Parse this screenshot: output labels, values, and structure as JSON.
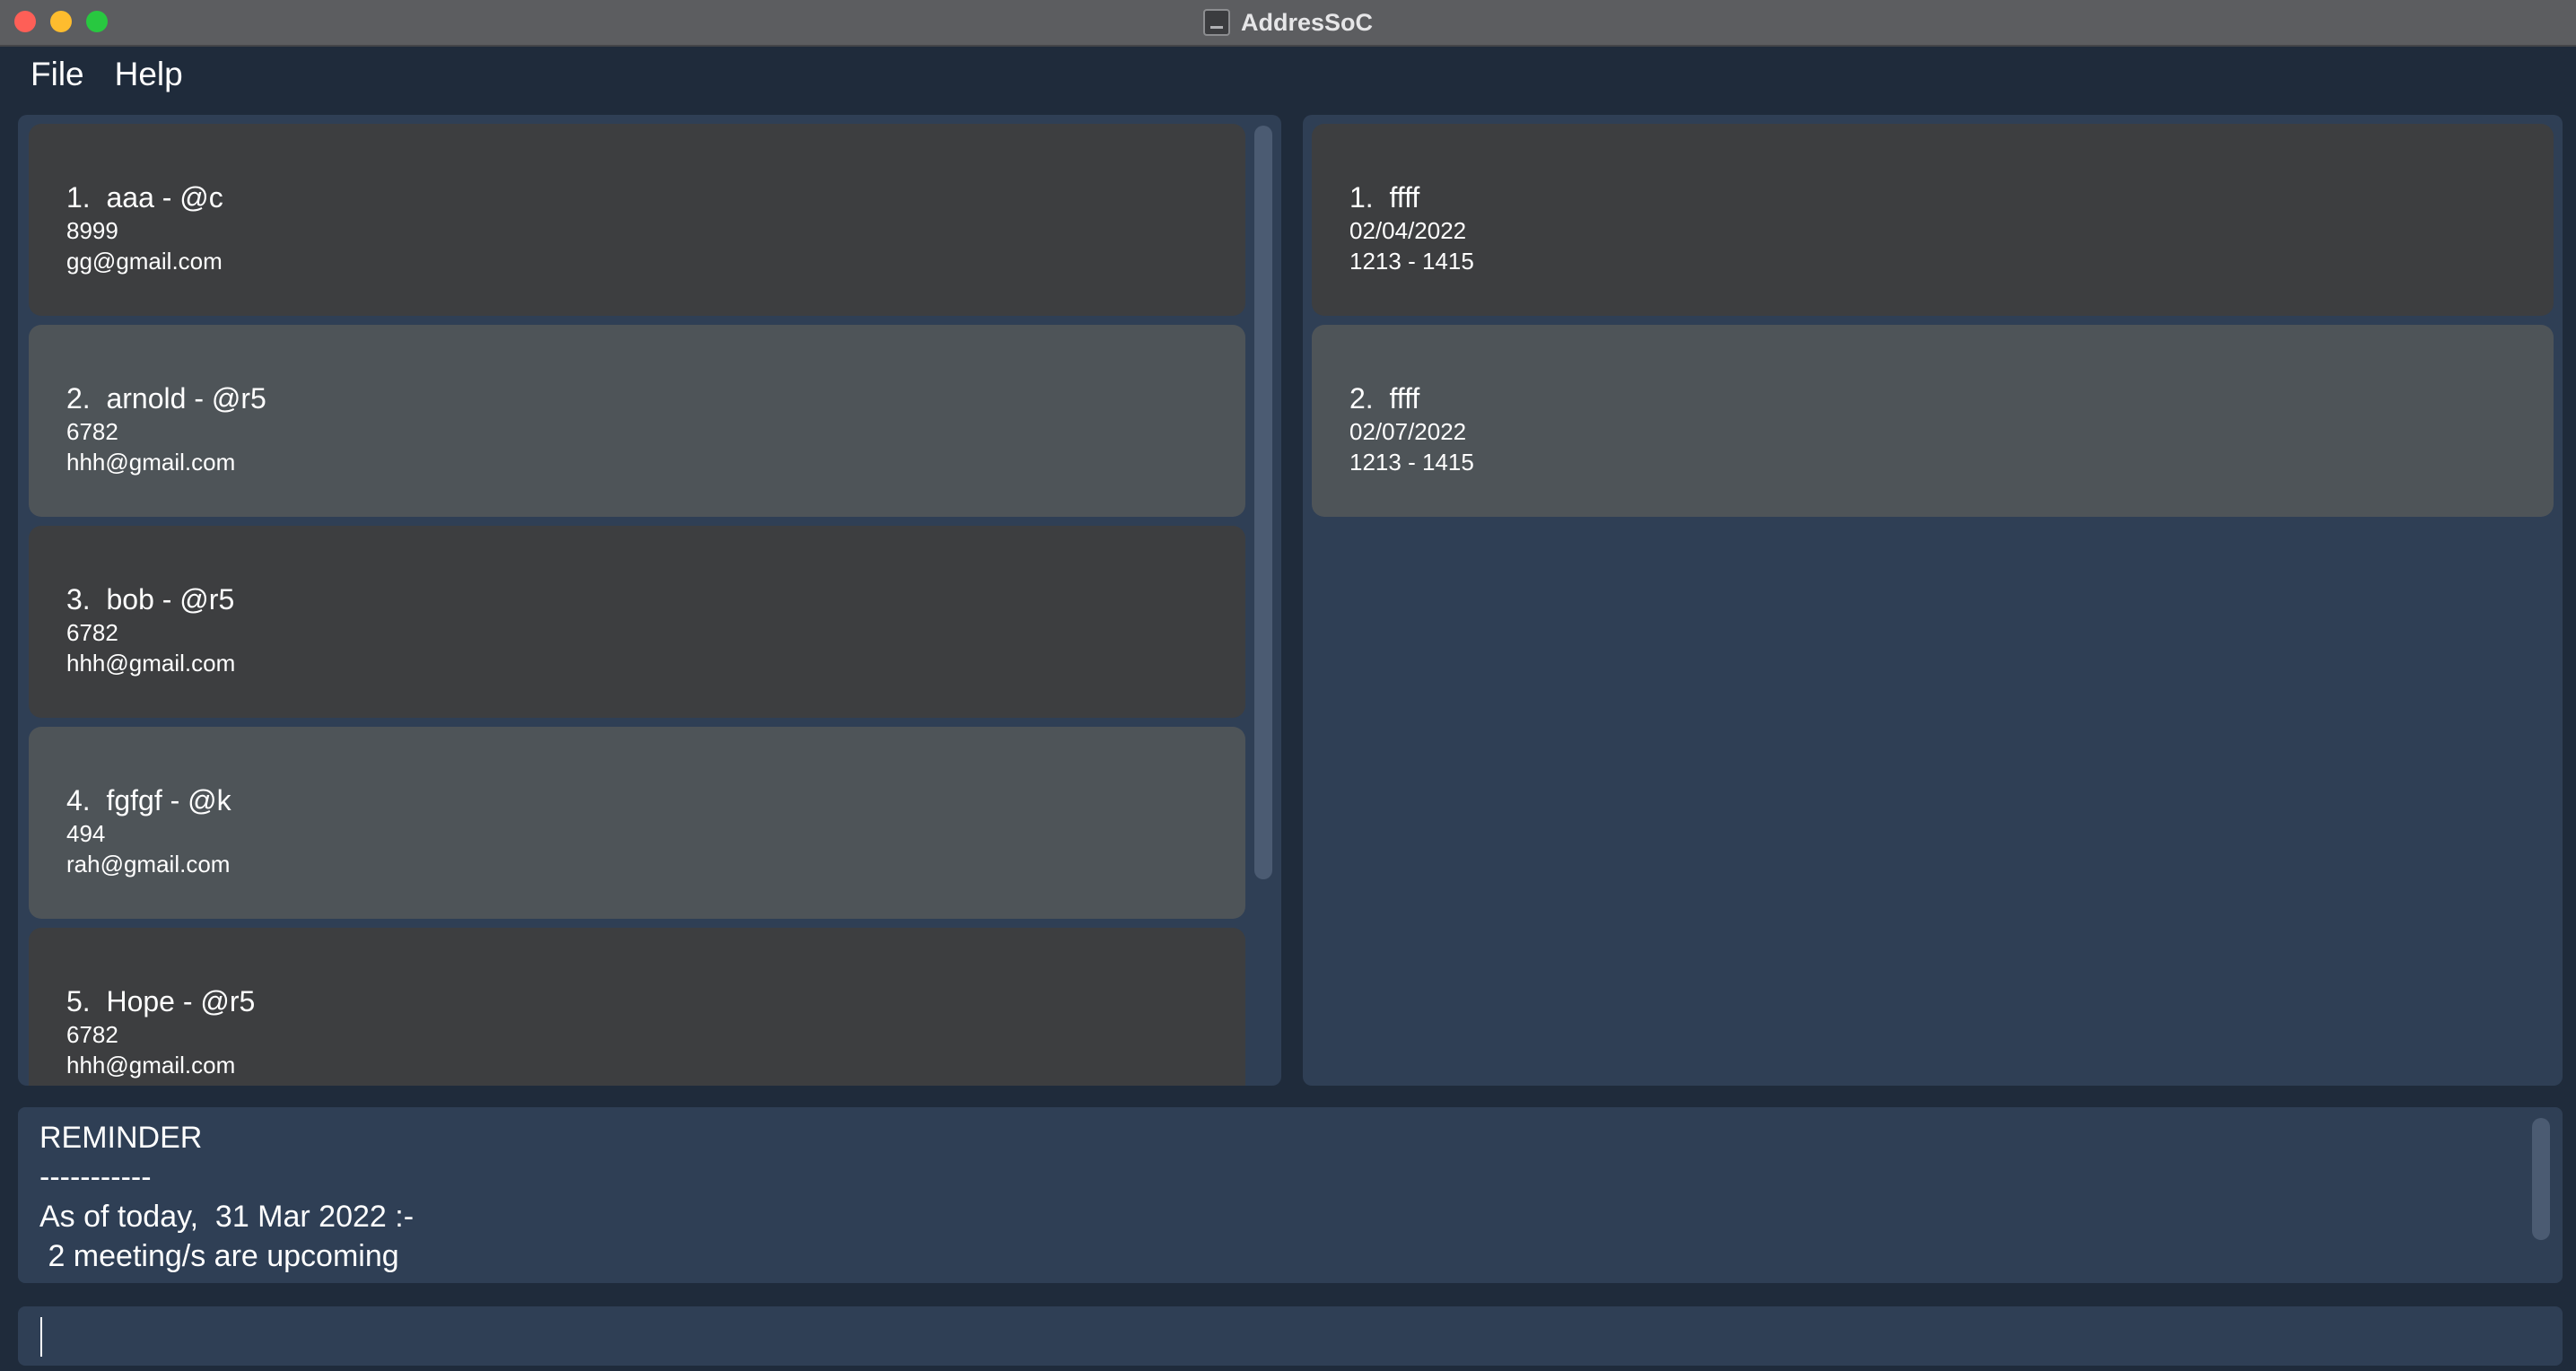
{
  "window": {
    "title": "AddresSoC",
    "icon": "app-window-icon"
  },
  "menu": {
    "file_label": "File",
    "help_label": "Help"
  },
  "persons": [
    {
      "index_name": "1.  aaa - @c",
      "phone": "8999",
      "email": "gg@gmail.com"
    },
    {
      "index_name": "2.  arnold - @r5",
      "phone": "6782",
      "email": "hhh@gmail.com"
    },
    {
      "index_name": "3.  bob - @r5",
      "phone": "6782",
      "email": "hhh@gmail.com"
    },
    {
      "index_name": "4.  fgfgf - @k",
      "phone": "494",
      "email": "rah@gmail.com"
    },
    {
      "index_name": "5.  Hope - @r5",
      "phone": "6782",
      "email": "hhh@gmail.com"
    }
  ],
  "meetings": [
    {
      "index_title": "1.  ffff",
      "date": "02/04/2022",
      "time": "1213 - 1415"
    },
    {
      "index_title": "2.  ffff",
      "date": "02/07/2022",
      "time": "1213 - 1415"
    }
  ],
  "reminder": {
    "heading": "REMINDER",
    "divider": "-----------",
    "date_line": "As of today,  31 Mar 2022 :-",
    "count_line": " 2 meeting/s are upcoming"
  },
  "command": {
    "value": "",
    "placeholder": ""
  },
  "colors": {
    "background": "#1f2b3b",
    "panel": "#2f3f55",
    "card_dark": "#3d3e40",
    "card_light": "#4e5458"
  }
}
